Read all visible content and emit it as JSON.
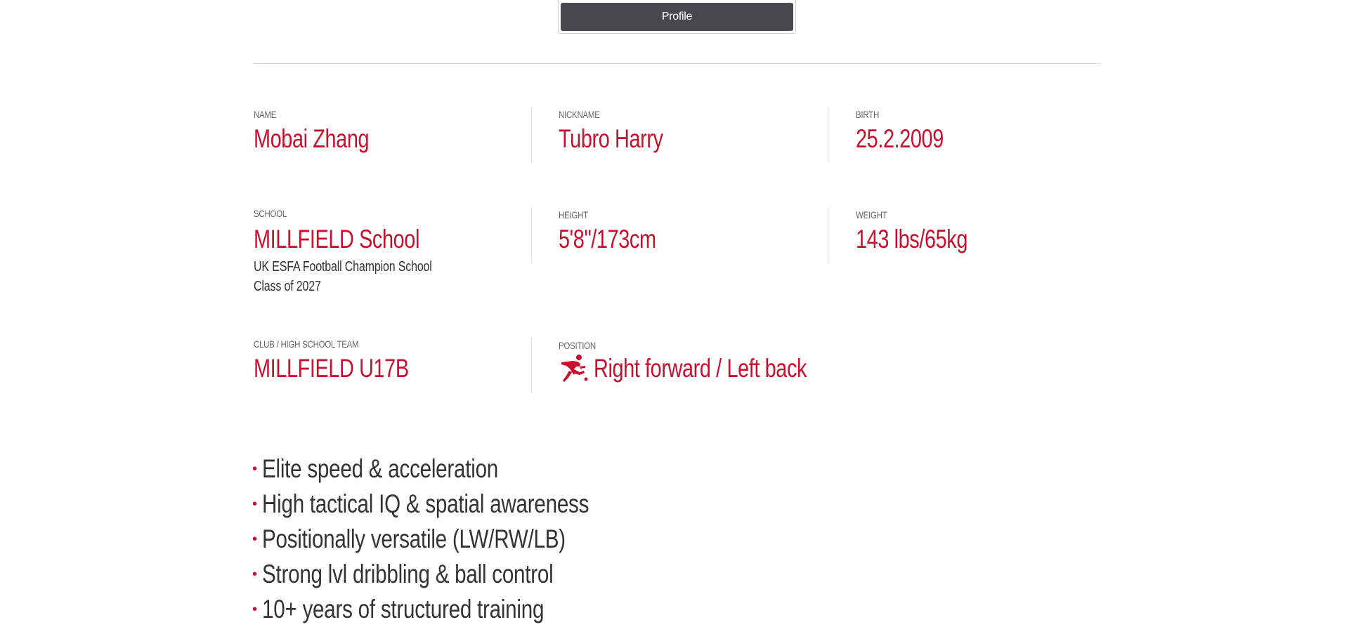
{
  "tab": {
    "label": "Profile"
  },
  "profile": {
    "name": {
      "label": "NAME",
      "value": "Mobai Zhang"
    },
    "nickname": {
      "label": "NICKNAME",
      "value": "Tubro Harry"
    },
    "birth": {
      "label": "BIRTH",
      "value": "25.2.2009"
    },
    "school": {
      "label": "SCHOOL",
      "value": "MILLFIELD School",
      "line1": "UK ESFA Football Champion School",
      "line2": "Class of 2027"
    },
    "height": {
      "label": "HEIGHT",
      "value": "5'8\"/173cm"
    },
    "weight": {
      "label": "WEIGHT",
      "value": "143 lbs/65kg"
    },
    "club": {
      "label": "CLUB / HIGH SCHOOL TEAM",
      "value": "MILLFIELD U17B"
    },
    "position": {
      "label": "POSITION",
      "value": "Right forward / Left back",
      "icon": "soccer-player-kick-icon"
    }
  },
  "highlights": [
    "Elite speed & acceleration",
    "High tactical IQ & spatial awareness",
    "Positionally versatile (LW/RW/LB)",
    "Strong lvl dribbling & ball control",
    "10+ years of structured training"
  ],
  "colors": {
    "accent": "#c8102e",
    "tab_bg": "#47474c",
    "text": "#333333",
    "label": "#666666"
  }
}
